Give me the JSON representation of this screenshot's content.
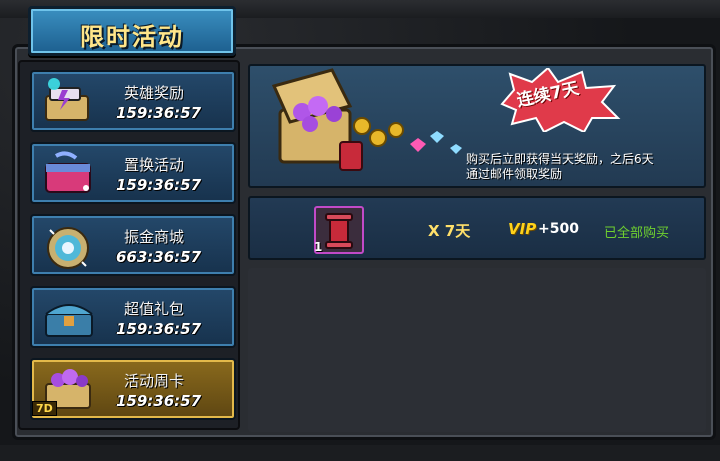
{
  "title": "限时活动",
  "tabs": [
    {
      "label": "英雄奖励",
      "timer": "159:36:57",
      "icon": "hero-chest-icon"
    },
    {
      "label": "置换活动",
      "timer": "159:36:57",
      "icon": "exchange-box-icon"
    },
    {
      "label": "振金商城",
      "timer": "663:36:57",
      "icon": "vibranium-shield-icon"
    },
    {
      "label": "超值礼包",
      "timer": "159:36:57",
      "icon": "gift-chest-icon"
    },
    {
      "label": "活动周卡",
      "timer": "159:36:57",
      "icon": "gem-chest-icon",
      "badge": "7D",
      "active": true
    }
  ],
  "banner": {
    "burst_text": "连续7天",
    "line1": "购买后立即获得当天奖励，之后6天",
    "line2": "通过邮件领取奖励"
  },
  "reward": {
    "count": "1",
    "days": "X 7天",
    "vip_label": "VIP",
    "vip_points": "+500",
    "status": "已全部购买"
  },
  "colors": {
    "tab_blue": "#24486a",
    "tab_active_gold": "#8a6a1d",
    "status_green": "#6fd12f",
    "vip_gold": "#ffd21a"
  }
}
